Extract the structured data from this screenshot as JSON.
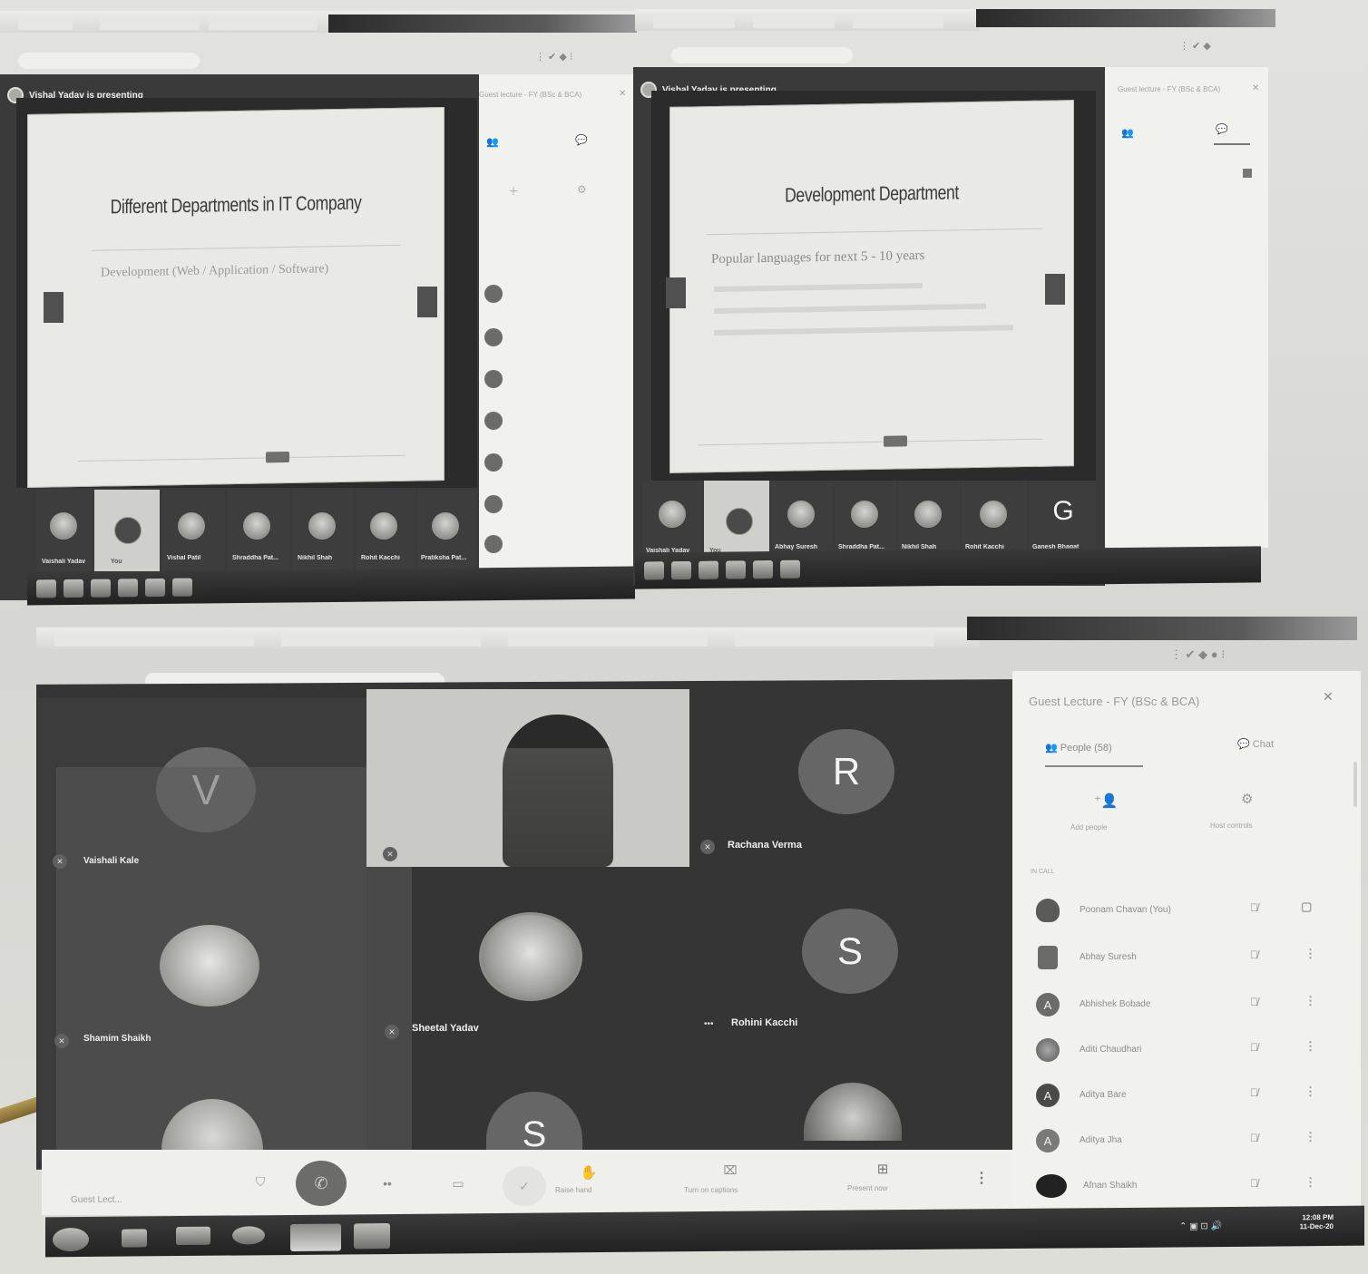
{
  "screen_a": {
    "presenter_banner": "Vishal Yadav is presenting",
    "slide_title": "Different Departments in IT Company",
    "slide_subtitle": "Development (Web / Application / Software)",
    "meeting_title": "Guest lecture - FY (BSc & BCA)",
    "film_names": [
      "Vaishali Yadav",
      "You",
      "Vishal Patil",
      "Shraddha Pat...",
      "Nikhil Shah",
      "Rohit Kacchi",
      "Pratiksha Pat..."
    ]
  },
  "screen_b": {
    "presenter_banner": "Vishal Yadav is presenting",
    "slide_title": "Development Department",
    "slide_subtitle": "Popular languages for next 5 - 10 years",
    "meeting_title": "Guest lecture - FY (BSc & BCA)",
    "film_names": [
      "Vaishali Yadav",
      "You",
      "Abhay Suresh",
      "Shraddha Pat...",
      "Nikhil Shah",
      "Rohit Kacchi",
      "Ganesh Bhagat"
    ],
    "film_letter": "G"
  },
  "screen_c": {
    "meeting_title": "Guest Lecture - FY (BSc & BCA)",
    "tab_people": "People (58)",
    "tab_chat": "Chat",
    "add_people": "Add people",
    "host_controls": "Host controls",
    "in_call": "IN CALL",
    "participants": [
      {
        "name": "Poonam Chavan (You)",
        "initial": ""
      },
      {
        "name": "Abhay Suresh",
        "initial": ""
      },
      {
        "name": "Abhishek Bobade",
        "initial": "A"
      },
      {
        "name": "Aditi Chaudhari",
        "initial": ""
      },
      {
        "name": "Aditya Bare",
        "initial": "A"
      },
      {
        "name": "Aditya Jha",
        "initial": "A"
      },
      {
        "name": "Afnan Shaikh",
        "initial": ""
      }
    ],
    "tiles": {
      "v_letter": "V",
      "v_name": "Vaishali Kale",
      "r_letter": "R",
      "r_name": "Rachana Verma",
      "s_letter": "S",
      "s_name": "Rohini Kacchi",
      "mid_name": "Sheetal Yadav",
      "bottom_left_name": "Shamim Shaikh",
      "s2_letter": "S"
    },
    "controls": {
      "meeting_code": "Guest Lect...",
      "raise_hand": "Raise hand",
      "captions": "Turn on captions",
      "present": "Present now"
    },
    "clock_time": "12:08 PM",
    "clock_date": "11-Dec-20"
  },
  "colors": {
    "meet_dark": "#3a3a3a",
    "panel_bg": "#f1f1ee",
    "end_call": "#6c6c69"
  }
}
